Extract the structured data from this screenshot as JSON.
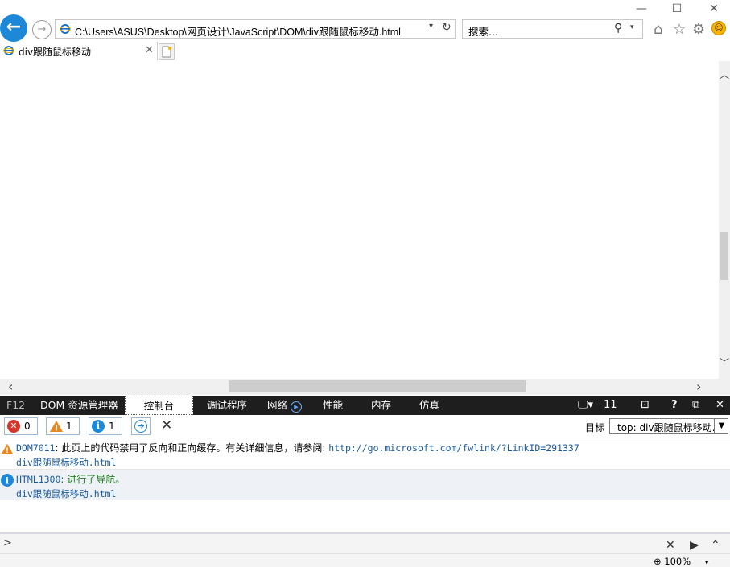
{
  "browser": {
    "address": "C:\\Users\\ASUS\\Desktop\\网页设计\\JavaScript\\DOM\\div跟随鼠标移动.html",
    "search_placeholder": "搜索...",
    "tab_title": "div跟随鼠标移动"
  },
  "devtools": {
    "tabs": [
      {
        "label": "F12"
      },
      {
        "label": "DOM 资源管理器"
      },
      {
        "label": "控制台"
      },
      {
        "label": "调试程序"
      },
      {
        "label": "网络"
      },
      {
        "label": "性能"
      },
      {
        "label": "内存"
      },
      {
        "label": "仿真"
      }
    ],
    "active_tab": "控制台",
    "doc_mode": "11",
    "filters": {
      "errors": "0",
      "warnings": "1",
      "info": "1"
    },
    "target_label": "目标",
    "target_value": "_top: div跟随鼠标移动.h",
    "messages": [
      {
        "type": "warning",
        "code": "DOM7011",
        "text": ": 此页上的代码禁用了反向和正向缓存。有关详细信息，请参阅: ",
        "link": "http://go.microsoft.com/fwlink/?LinkID=291337",
        "source": "div跟随鼠标移动.html"
      },
      {
        "type": "info",
        "code": "HTML1300",
        "text": ": 进行了导航。",
        "source": "div跟随鼠标移动.html"
      }
    ],
    "prompt": ">",
    "zoom": "100%"
  },
  "colors": {
    "back_button": "#1e88d8",
    "devtools_bar": "#1e1e1e",
    "warning": "#e8871e",
    "info": "#1e88d8",
    "error": "#d9322a"
  }
}
